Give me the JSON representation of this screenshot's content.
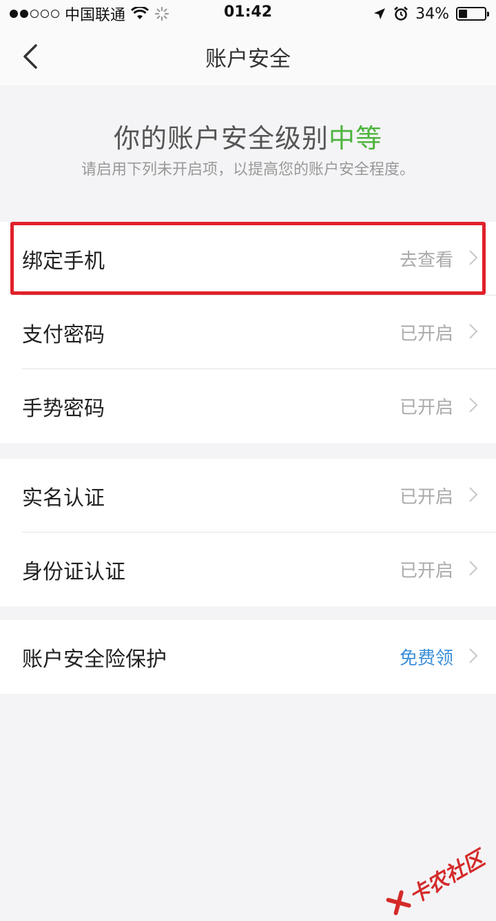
{
  "status_bar": {
    "carrier": "中国联通",
    "time": "01:42",
    "battery": "34%",
    "battery_level": 0.34
  },
  "nav": {
    "title": "账户安全",
    "back_icon": "chevron-left-icon"
  },
  "header": {
    "title_prefix": "你的账户安全级别",
    "level": "中等",
    "level_color": "#4db33d",
    "subtitle": "请启用下列未开启项，以提高您的账户安全程度。"
  },
  "group1": [
    {
      "label": "绑定手机",
      "status": "去查看"
    },
    {
      "label": "支付密码",
      "status": "已开启"
    },
    {
      "label": "手势密码",
      "status": "已开启"
    }
  ],
  "group2": [
    {
      "label": "实名认证",
      "status": "已开启"
    },
    {
      "label": "身份证认证",
      "status": "已开启"
    }
  ],
  "group3": [
    {
      "label": "账户安全险保护",
      "status": "免费领"
    }
  ],
  "colors": {
    "highlight_border": "#e0212a",
    "link_blue": "#3b8fd9",
    "status_gray": "#aaaaaa"
  },
  "watermark": {
    "text": "卡农社区"
  }
}
